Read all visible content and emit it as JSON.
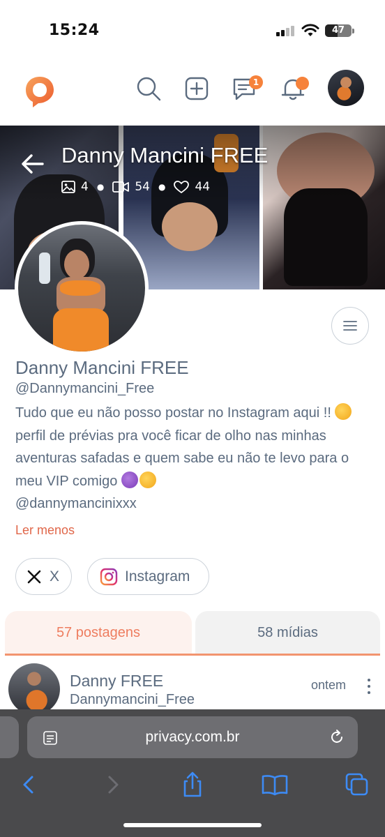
{
  "status_bar": {
    "time": "15:24",
    "battery": "47"
  },
  "nav": {
    "messages_badge": "1"
  },
  "cover": {
    "title": "Danny Mancini FREE",
    "photos_count": "4",
    "videos_count": "54",
    "likes_count": "44"
  },
  "profile": {
    "name": "Danny Mancini FREE",
    "handle": "@Dannymancini_Free",
    "bio_part1": "Tudo que eu não posso postar no Instagram aqui !! ",
    "bio_part2": " perfil de prévias pra você ficar de olho nas minhas aventuras safadas e quem sabe eu não te levo para o meu VIP comigo ",
    "bio_part3": "@dannymancinixxx",
    "read_less": "Ler menos"
  },
  "social": {
    "x_label": "X",
    "instagram_label": "Instagram"
  },
  "tabs": {
    "posts": "57 postagens",
    "media": "58 mídias"
  },
  "post": {
    "name": "Danny FREE",
    "handle": "Dannymancini_Free",
    "time": "ontem"
  },
  "browser": {
    "url": "privacy.com.br"
  },
  "colors": {
    "accent": "#f6823b",
    "link": "#e0674a",
    "text": "#5b6b7f",
    "tab_active_bg": "#fdf2ee"
  },
  "icons": [
    "logo-icon",
    "search-icon",
    "add-post-icon",
    "messages-icon",
    "bell-icon",
    "back-arrow-icon",
    "photo-icon",
    "video-icon",
    "heart-icon",
    "menu-icon",
    "x-logo-icon",
    "instagram-icon",
    "more-vertical-icon",
    "reader-icon",
    "reload-icon",
    "back-icon",
    "forward-icon",
    "share-icon",
    "bookmarks-icon",
    "tabs-icon"
  ]
}
